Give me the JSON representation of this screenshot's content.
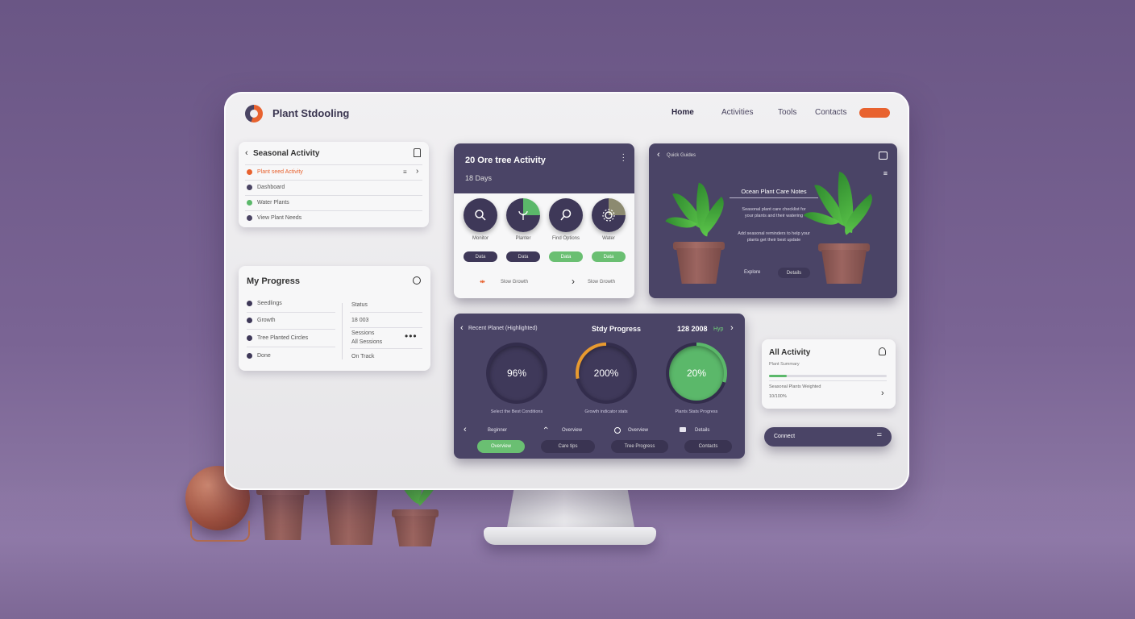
{
  "header": {
    "brand": "Plant Stdooling",
    "nav": [
      "Home",
      "Activities",
      "Tools",
      "Contacts"
    ]
  },
  "recent_activity": {
    "title": "Seasonal Activity",
    "items": [
      {
        "label": "Plant seed Activity",
        "color": "#e8622f"
      },
      {
        "label": "Dashboard",
        "color": "#4a4463"
      },
      {
        "label": "Water Plants",
        "color": "#5bb86a"
      },
      {
        "label": "View Plant Needs",
        "color": "#4a4463"
      }
    ]
  },
  "my_progress": {
    "title": "My Progress",
    "left": [
      "Seedlings",
      "Growth",
      "Tree Planted Circles",
      "Done"
    ],
    "right": [
      "Status",
      "18 003",
      "Sessions",
      "All Sessions",
      "On Track"
    ]
  },
  "activity_card": {
    "title": "20 Ore tree Activity",
    "subtitle": "18 Days",
    "icons": [
      {
        "label": "Monitor",
        "icon": "search-icon",
        "pill": "Data"
      },
      {
        "label": "Planter",
        "icon": "sprout-icon",
        "pill": "Data"
      },
      {
        "label": "Find Options",
        "icon": "magnifier-icon",
        "pill": "Data"
      },
      {
        "label": "Water",
        "icon": "gear-icon",
        "pill": "Data"
      }
    ],
    "footer_left": "Slow Growth",
    "footer_right": "Slow Growth"
  },
  "plant_feature": {
    "back": "Quick Guides",
    "heading": "Ocean Plant Care Notes",
    "text1": "Seasonal plant care checklist for your plants and their watering",
    "text2": "Add seasonal reminders to help your plants get their best update",
    "btn1": "Explore",
    "btn2": "Details"
  },
  "study_progress": {
    "left_label": "Recent Planet (Highlighted)",
    "title": "Stdy Progress",
    "right_label": "128 2008",
    "right_badge": "Hyp",
    "rings": [
      {
        "value": "96%",
        "caption": "Select the Best Conditions",
        "fill": 0.0,
        "color": "#3f395a"
      },
      {
        "value": "200%",
        "caption": "Growth indicator stats",
        "fill": 0.28,
        "color": "#e89a2f"
      },
      {
        "value": "20%",
        "caption": "Plants Stats Progress",
        "fill": 0.3,
        "color": "#5bb86a"
      }
    ],
    "bottom_row": [
      "Beginner",
      "Overview",
      "Overview",
      "Details"
    ],
    "bottom_pills": [
      "Overview",
      "Care tips",
      "Tree Progress",
      "Contacts"
    ]
  },
  "all_activity": {
    "title": "All Activity",
    "sub": "Plant Summary",
    "progress": 0.15,
    "line1": "Seasonal Plants Weighted",
    "line2": "10/100%"
  },
  "connect_bar": {
    "label": "Connect"
  }
}
